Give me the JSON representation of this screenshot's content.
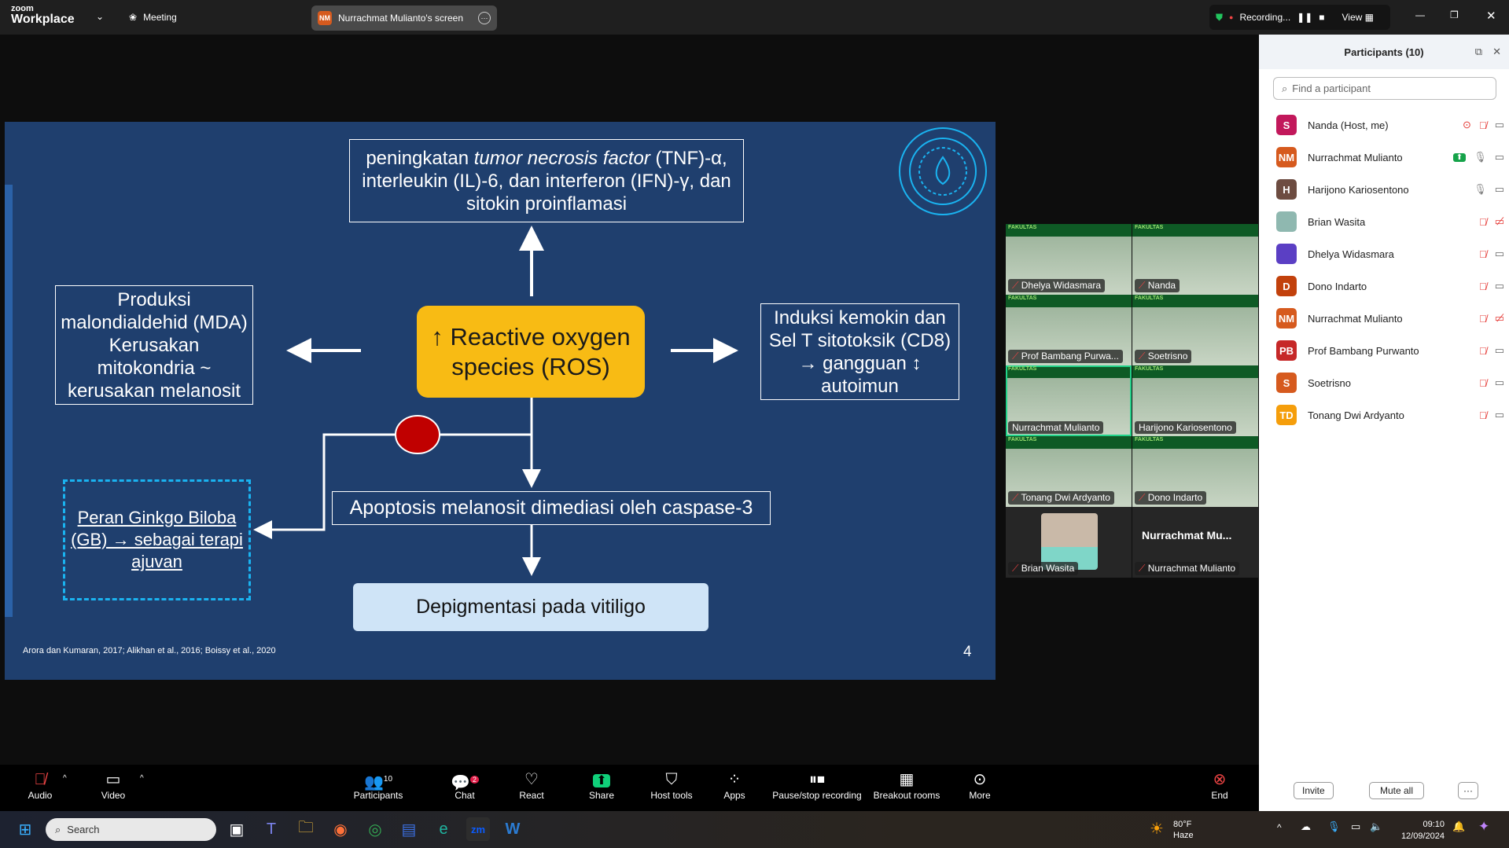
{
  "app": {
    "logo_top": "zoom",
    "logo_bottom": "Workplace",
    "meeting_label": "Meeting",
    "share_initials": "NM",
    "share_label": "Nurrachmat Mulianto's screen",
    "recording_label": "Recording...",
    "view_label": "View"
  },
  "slide": {
    "top_box_pre": "peningkatan ",
    "top_box_italic": "tumor necrosis factor",
    "top_box_post": " (TNF)-α, interleukin (IL)-6, dan interferon (IFN)-γ, dan sitokin proinflamasi",
    "left_box": "Produksi malondialdehid (MDA) Kerusakan mitokondria ~ kerusakan melanosit",
    "center": "↑ Reactive oxygen species (ROS)",
    "right_box": "Induksi kemokin dan Sel T sitotoksik (CD8) → gangguan ↕ autoimun",
    "apoptosis": "Apoptosis melanosit dimediasi oleh caspase-3",
    "depigmentasi": "Depigmentasi pada vitiligo",
    "ginkgo": "Peran Ginkgo Biloba (GB) → sebagai terapi ajuvan",
    "citation": "Arora dan Kumaran, 2017; Alikhan et al., 2016; Boissy et al., 2020",
    "page_number": "4"
  },
  "videos": [
    {
      "name": "Dhelya Widasmara",
      "header": "FAKULTAS"
    },
    {
      "name": "Nanda",
      "header": "FAKULTAS"
    },
    {
      "name": "Prof Bambang Purwa...",
      "header": "FAKULTAS"
    },
    {
      "name": "Soetrisno",
      "header": "FAKULTAS"
    },
    {
      "name": "Nurrachmat Mulianto",
      "header": "FAKULTAS"
    },
    {
      "name": "Harijono Kariosentono",
      "header": "FAKULTAS"
    },
    {
      "name": "Tonang Dwi Ardyanto",
      "header": "FAKULTAS"
    },
    {
      "name": "Dono Indarto",
      "header": "FAKULTAS"
    },
    {
      "name": "Brian Wasita"
    },
    {
      "name": "Nurrachmat Mulianto",
      "big_name": "Nurrachmat  Mu..."
    }
  ],
  "participants": {
    "title": "Participants (10)",
    "search_placeholder": "Find a participant",
    "list": [
      {
        "initials": "S",
        "name": "Nanda (Host, me)",
        "color": "#c2185b",
        "mic": "muted",
        "cam": "on"
      },
      {
        "initials": "NM",
        "name": "Nurrachmat Mulianto",
        "color": "#d65a1e",
        "mic": "on",
        "cam": "on",
        "sharing": true
      },
      {
        "initials": "H",
        "name": "Harijono Kariosentono",
        "color": "#6d4c41",
        "mic": "on",
        "cam": "on"
      },
      {
        "initials": "",
        "name": "Brian Wasita",
        "color": "#8fb8b0",
        "mic": "muted",
        "cam": "off"
      },
      {
        "initials": "",
        "name": "Dhelya Widasmara",
        "color": "#5b3fc4",
        "mic": "muted",
        "cam": "on"
      },
      {
        "initials": "D",
        "name": "Dono Indarto",
        "color": "#c2410c",
        "mic": "muted",
        "cam": "on"
      },
      {
        "initials": "NM",
        "name": "Nurrachmat Mulianto",
        "color": "#d65a1e",
        "mic": "muted",
        "cam": "off"
      },
      {
        "initials": "PB",
        "name": "Prof Bambang Purwanto",
        "color": "#c62828",
        "mic": "muted",
        "cam": "on"
      },
      {
        "initials": "S",
        "name": "Soetrisno",
        "color": "#d65a1e",
        "mic": "muted",
        "cam": "on"
      },
      {
        "initials": "TD",
        "name": "Tonang Dwi Ardyanto",
        "color": "#f59e0b",
        "mic": "muted",
        "cam": "on"
      }
    ],
    "invite": "Invite",
    "mute_all": "Mute all",
    "more": "···"
  },
  "toolbar": {
    "audio": "Audio",
    "video": "Video",
    "participants": "Participants",
    "participants_count": "10",
    "chat": "Chat",
    "chat_badge": "2",
    "react": "React",
    "share": "Share",
    "host_tools": "Host tools",
    "apps": "Apps",
    "pause_stop": "Pause/stop recording",
    "breakout": "Breakout rooms",
    "more": "More",
    "end": "End"
  },
  "taskbar": {
    "search_placeholder": "Search",
    "weather_temp": "80°F",
    "weather_desc": "Haze",
    "time": "09:10",
    "date": "12/09/2024"
  }
}
